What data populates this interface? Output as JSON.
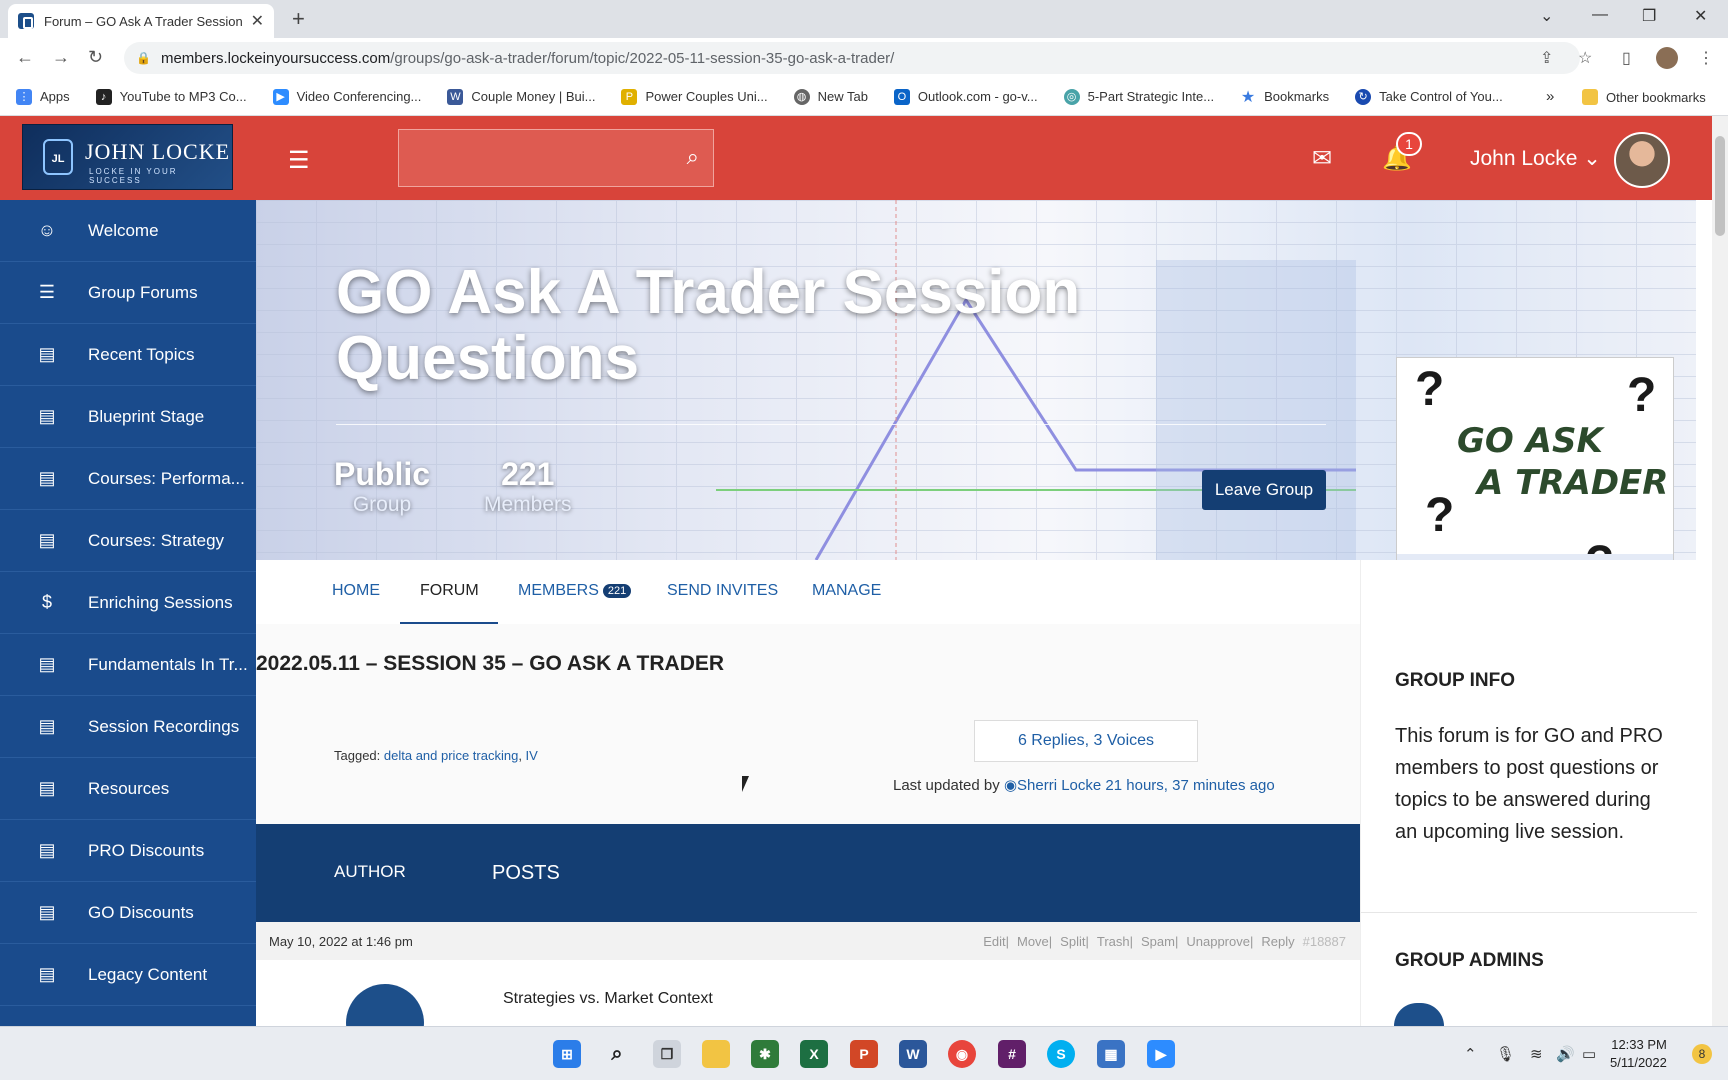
{
  "browser": {
    "tab_title": "Forum – GO Ask A Trader Session",
    "url_host": "members.lockeinyoursuccess.com",
    "url_path": "/groups/go-ask-a-trader/forum/topic/2022-05-11-session-35-go-ask-a-trader/",
    "bookmarks": [
      {
        "label": "Apps",
        "color": "#4285f4"
      },
      {
        "label": "YouTube to MP3 Co...",
        "color": "#222222"
      },
      {
        "label": "Video Conferencing...",
        "color": "#2d8cff"
      },
      {
        "label": "Couple Money | Bui...",
        "color": "#3b5998"
      },
      {
        "label": "Power Couples Uni...",
        "color": "#e0b000"
      },
      {
        "label": "New Tab",
        "color": "#666666"
      },
      {
        "label": "Outlook.com - go-v...",
        "color": "#0a64c8"
      },
      {
        "label": "5-Part Strategic Inte...",
        "color": "#49a3a8"
      },
      {
        "label": "Bookmarks",
        "color": "#3a7be0"
      },
      {
        "label": "Take Control of You...",
        "color": "#1a4ab0"
      }
    ],
    "other_bookmarks": "Other bookmarks",
    "more": "»"
  },
  "header": {
    "logo_name": "JOHN LOCKE",
    "logo_tag": "LOCKE IN YOUR SUCCESS",
    "logo_mark": "JL",
    "notification_count": "1",
    "user_name": "John Locke"
  },
  "sidebar": {
    "items": [
      {
        "label": "Welcome",
        "icon": "☺"
      },
      {
        "label": "Group Forums",
        "icon": "☰"
      },
      {
        "label": "Recent Topics",
        "icon": "▤"
      },
      {
        "label": "Blueprint Stage",
        "icon": "▤"
      },
      {
        "label": "Courses: Performa...",
        "icon": "▤"
      },
      {
        "label": "Courses: Strategy",
        "icon": "▤"
      },
      {
        "label": "Enriching Sessions",
        "icon": "$"
      },
      {
        "label": "Fundamentals In Tr...",
        "icon": "▤"
      },
      {
        "label": "Session Recordings",
        "icon": "▤"
      },
      {
        "label": "Resources",
        "icon": "▤"
      },
      {
        "label": "PRO Discounts",
        "icon": "▤"
      },
      {
        "label": "GO Discounts",
        "icon": "▤"
      },
      {
        "label": "Legacy Content",
        "icon": "▤"
      }
    ]
  },
  "hero": {
    "title": "GO Ask A Trader Session Questions",
    "visibility": "Public",
    "visibility_label": "Group",
    "members_count": "221",
    "members_label": "Members",
    "leave_button": "Leave Group",
    "cover_text_1": "GO ASK",
    "cover_text_2": "A TRADER"
  },
  "nav": {
    "tabs": [
      {
        "label": "HOME"
      },
      {
        "label": "FORUM"
      },
      {
        "label": "MEMBERS",
        "count": "221"
      },
      {
        "label": "SEND INVITES"
      },
      {
        "label": "MANAGE"
      }
    ]
  },
  "topic": {
    "title": "2022.05.11 – Session 35 – GO Ask A Trader",
    "replies": "6 Replies, 3 Voices",
    "tagged_prefix": "Tagged:",
    "tags": [
      "delta and price tracking",
      "IV"
    ],
    "last_updated_prefix": "Last updated by",
    "last_updated_by": "Sherri Locke",
    "last_updated_ago": "21 hours, 37 minutes ago"
  },
  "posts": {
    "author_header": "AUTHOR",
    "posts_header": "POSTS",
    "first_post": {
      "date": "May 10, 2022 at 1:46 pm",
      "actions": [
        "Edit",
        "Move",
        "Split",
        "Trash",
        "Spam",
        "Unapprove",
        "Reply"
      ],
      "id": "#18887",
      "title": "Strategies vs. Market Context"
    }
  },
  "right": {
    "group_info_title": "GROUP INFO",
    "group_info_text": "This forum is for GO and PRO members to post questions or topics to be answered during an upcoming live session.",
    "group_admins_title": "GROUP ADMINS"
  },
  "taskbar": {
    "time": "12:33 PM",
    "date": "5/11/2022",
    "notif": "8"
  }
}
